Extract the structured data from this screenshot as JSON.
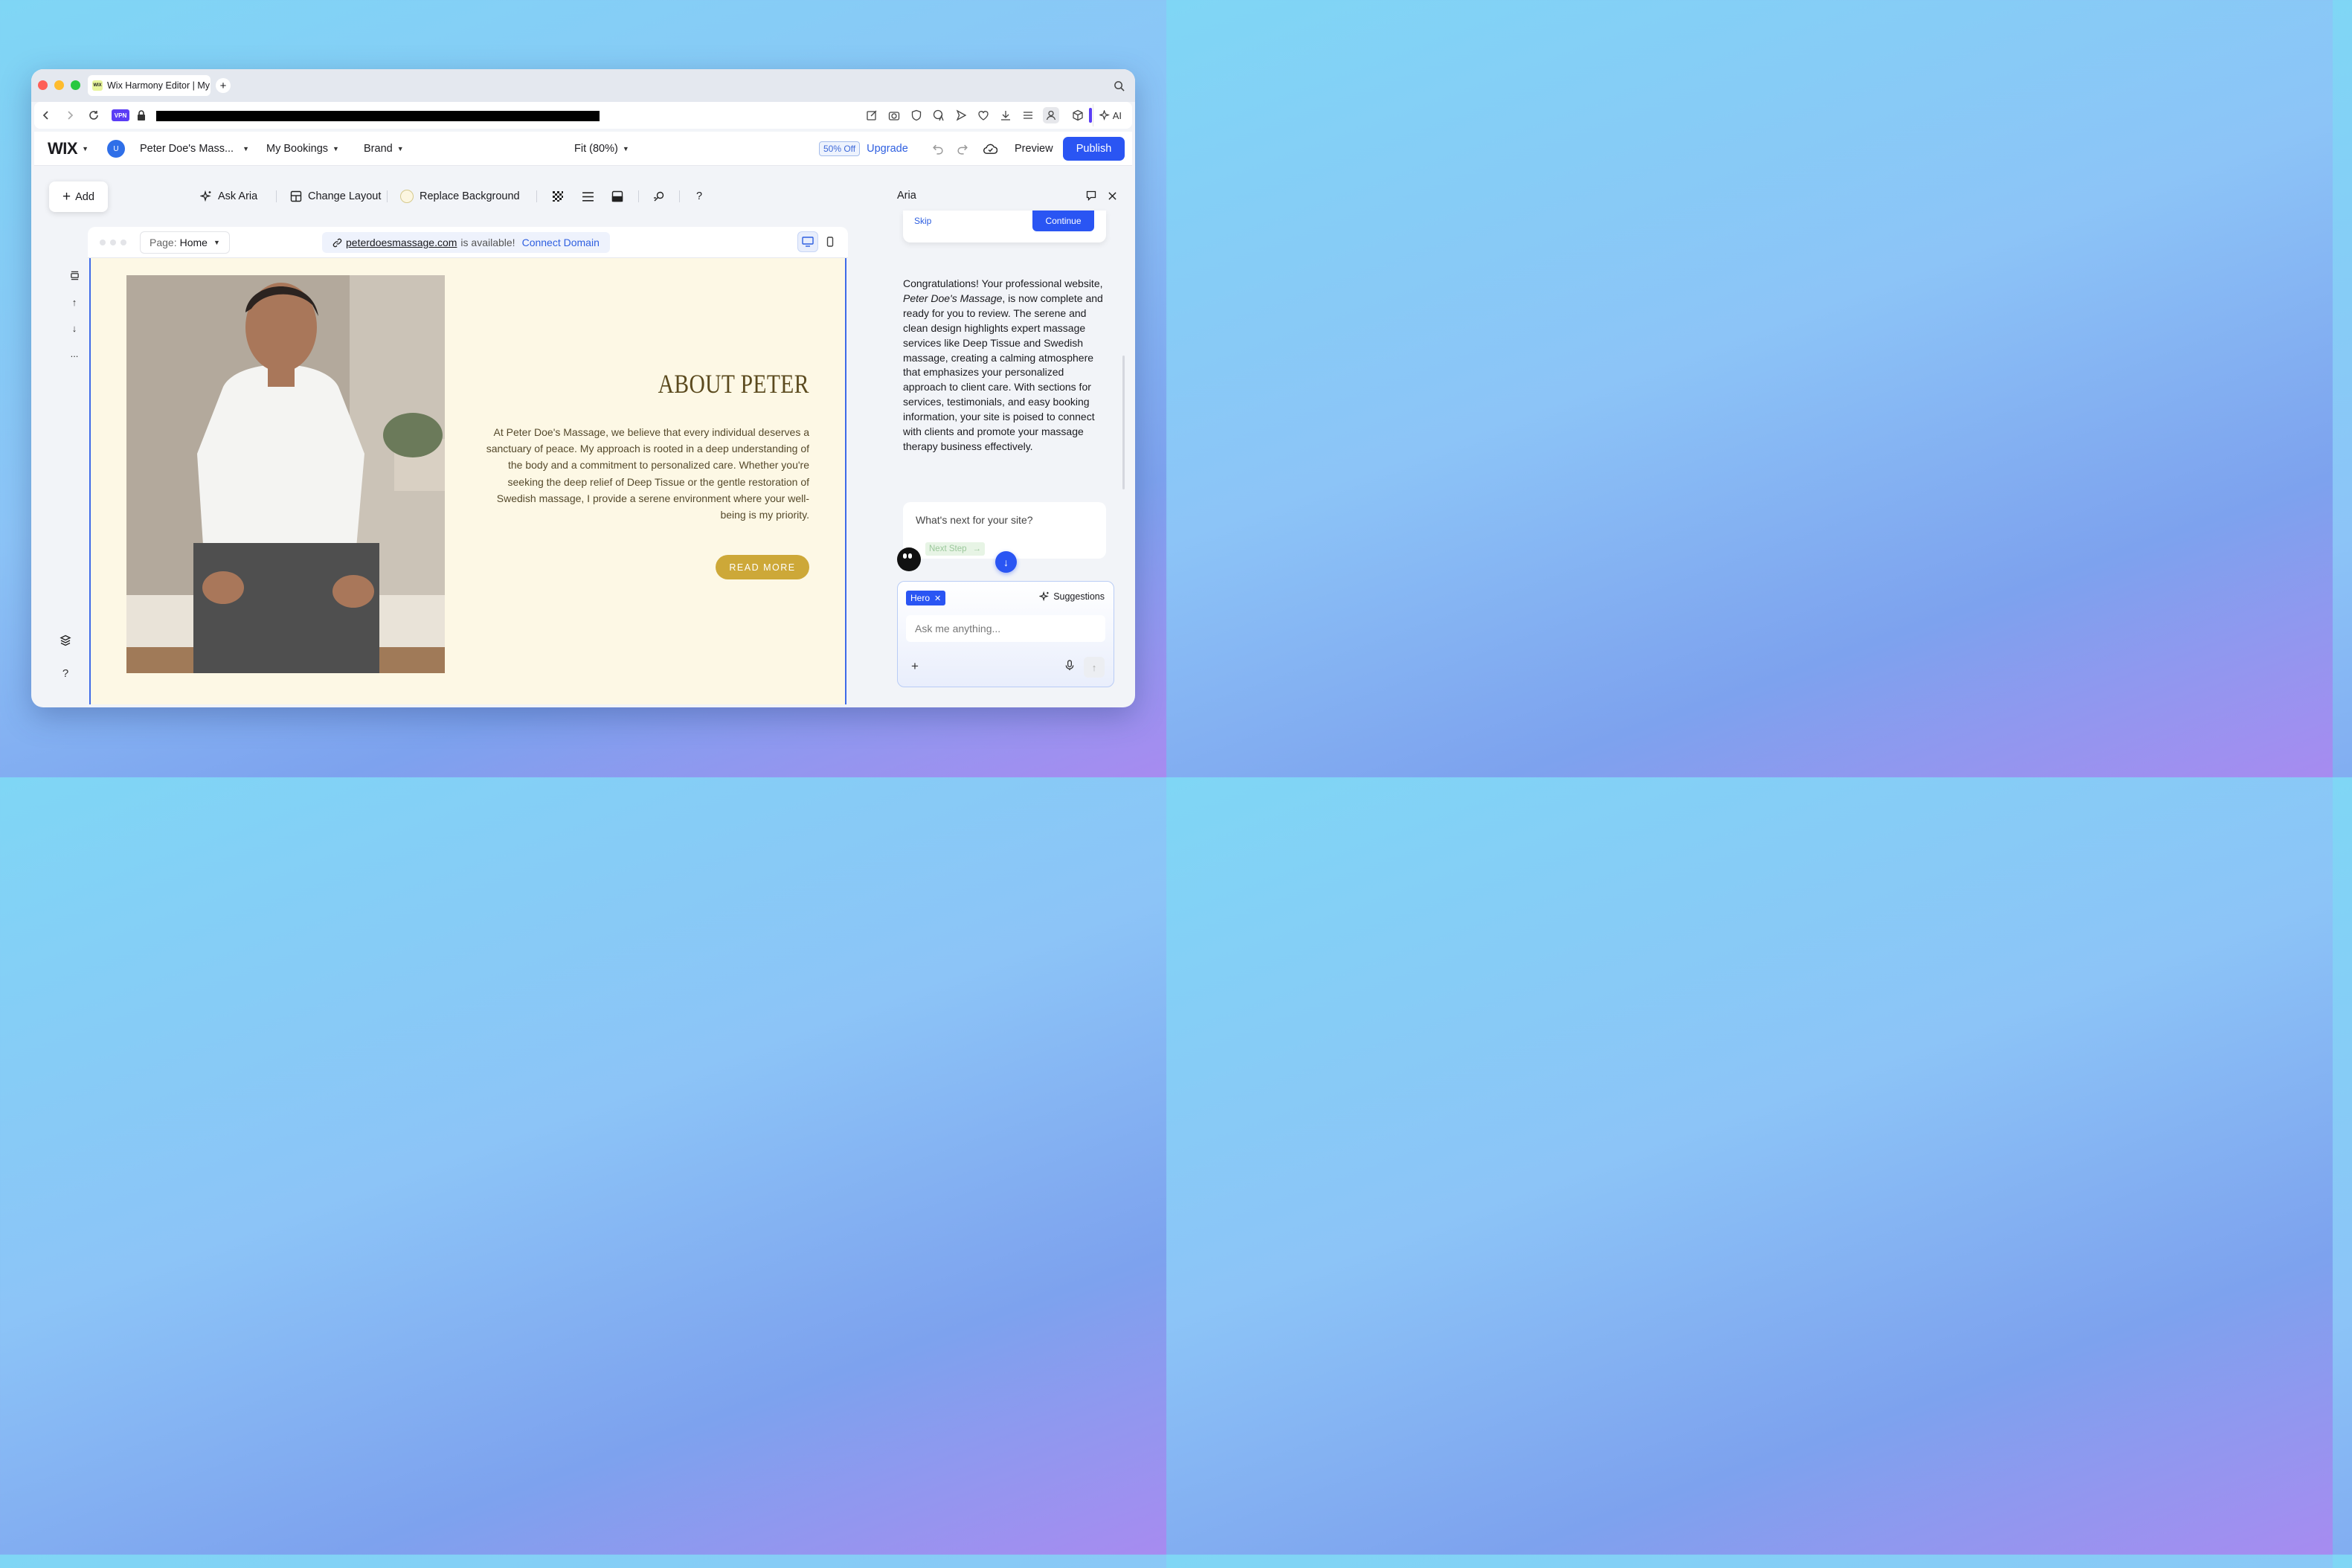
{
  "browser": {
    "tab_title": "Wix Harmony Editor | My",
    "favicon_text": "WIX",
    "new_tab": "+",
    "vpn_label": "VPN",
    "ai_label": "AI"
  },
  "editor_top": {
    "logo": "WIX",
    "avatar_initial": "U",
    "site_name": "Peter Doe's Mass...",
    "my_bookings": "My Bookings",
    "brand": "Brand",
    "zoom": "Fit (80%)",
    "discount_badge": "50% Off",
    "upgrade": "Upgrade",
    "preview": "Preview",
    "publish": "Publish"
  },
  "toolbar": {
    "add": "Add",
    "ask_aria": "Ask Aria",
    "change_layout": "Change Layout",
    "replace_background": "Replace Background",
    "help": "?"
  },
  "canvas": {
    "page_prefix": "Page:",
    "page_name": "Home",
    "domain": "peterdoesmassage.com",
    "domain_status": "is available!",
    "connect_domain": "Connect Domain"
  },
  "site": {
    "about_title": "ABOUT PETER",
    "about_body": "At Peter Doe's Massage, we believe that every individual deserves a sanctuary of peace. My approach is rooted in a deep understanding of the body and a commitment to personalized care. Whether you're seeking the deep relief of Deep Tissue or the gentle restoration of Swedish massage, I provide a serene environment where your well-being is my priority.",
    "read_more": "READ MORE"
  },
  "aria": {
    "title": "Aria",
    "skip": "Skip",
    "continue": "Continue",
    "message_part1": "Congratulations! Your professional website, ",
    "message_site": "Peter Doe's Massage",
    "message_part2": ", is now complete and ready for you to review. The serene and clean design highlights expert massage services like Deep Tissue and Swedish massage, creating a calming atmosphere that emphasizes your personalized approach to client care. With sections for services, testimonials, and easy booking information, your site is poised to connect with clients and promote your massage therapy business effectively.",
    "next_question": "What's next for your site?",
    "next_step": "Next Step",
    "hero_chip": "Hero",
    "suggestions": "Suggestions",
    "ask_placeholder": "Ask me anything..."
  },
  "left_rail": {
    "more": "...",
    "help": "?"
  },
  "colors": {
    "accent": "#2a55f3",
    "site_bg": "#fdf8e5",
    "read_more_bg": "#cda838",
    "title_color": "#5b4a1e"
  }
}
